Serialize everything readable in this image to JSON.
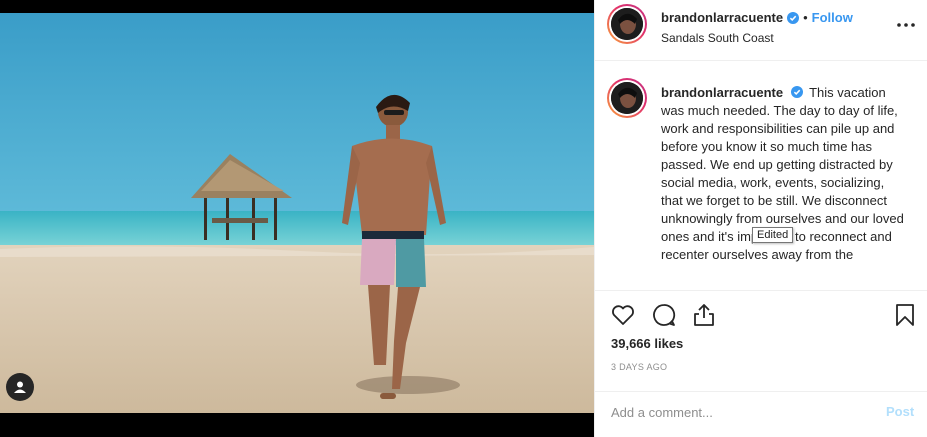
{
  "post": {
    "username": "brandonlarracuente",
    "location": "Sandals South Coast",
    "follow_label": "Follow",
    "separator": "•",
    "caption": "This vacation was much needed. The day to day of life, work and responsibilities can pile up and before you know it so much time has passed. We end up getting distracted by social media, work, events, socializing, that we forget to be still. We disconnect unknowingly from ourselves and our loved ones and it's important to reconnect and recenter ourselves away from the",
    "tooltip": "Edited",
    "likes": "39,666 likes",
    "time_ago": "3 DAYS AGO",
    "comment_placeholder": "Add a comment...",
    "post_label": "Post"
  },
  "icons": {
    "verified": "verified-badge-icon",
    "more": "more-options-icon",
    "like": "heart-icon",
    "comment": "comment-bubble-icon",
    "share": "share-icon",
    "save": "bookmark-icon",
    "tagged_user": "user-tag-icon"
  },
  "colors": {
    "accent": "#3897f0",
    "post_disabled": "#b2dffc",
    "muted_text": "#8e8e8e",
    "text": "#262626",
    "border": "#efefef"
  }
}
